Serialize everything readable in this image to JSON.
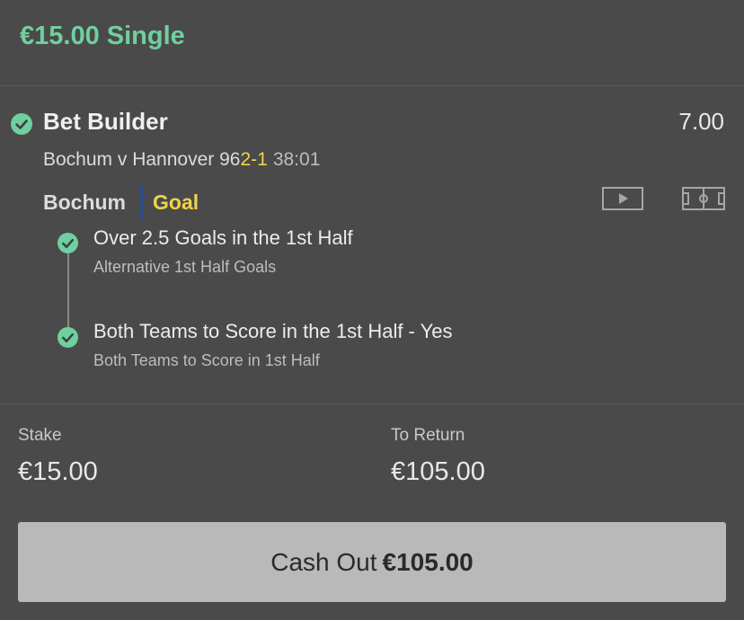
{
  "header": {
    "title": "€15.00 Single"
  },
  "bet": {
    "status_icon": "check-circle-icon",
    "title": "Bet Builder",
    "odds": "7.00",
    "match": "Bochum v Hannover 96",
    "score": "2-1",
    "clock": "38:01",
    "team": "Bochum",
    "event": "Goal",
    "icons": {
      "video": "play-video-icon",
      "pitch": "pitch-icon"
    },
    "legs": [
      {
        "title": "Over 2.5 Goals in the 1st Half",
        "market": "Alternative 1st Half Goals"
      },
      {
        "title": "Both Teams to Score in the 1st Half - Yes",
        "market": "Both Teams to Score in 1st Half"
      }
    ]
  },
  "summary": {
    "stake_label": "Stake",
    "stake_value": "€15.00",
    "return_label": "To Return",
    "return_value": "€105.00"
  },
  "cashout": {
    "label": "Cash Out",
    "amount": "€105.00"
  },
  "colors": {
    "background": "#4a4a4a",
    "accent_green": "#6fcf9f",
    "highlight_yellow": "#f2d24a",
    "team_divider": "#2f4e8a",
    "cashout_button": "#b9b9b9"
  }
}
